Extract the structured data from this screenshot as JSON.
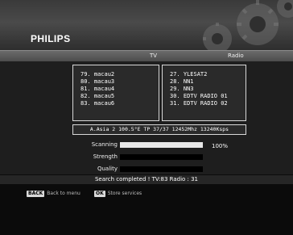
{
  "brand": "PHILIPS",
  "tabs": {
    "tv": "TV",
    "radio": "Radio"
  },
  "tv_channels": [
    "79. macau2",
    "80. macau3",
    "81. macau4",
    "82. macau5",
    "83. macau6"
  ],
  "radio_channels": [
    "27. YLESAT2",
    "28. NN1",
    "29. NN3",
    "30. EDTV RADIO 01",
    "31. EDTV RADIO 02"
  ],
  "transponder": "A.Asia 2 100.5°E TP 37/37  12452Mhz 13240Ksps",
  "scan": {
    "scanning_label": "Scanning",
    "scanning_percent": "100%",
    "scanning_progress": 1.0,
    "strength_label": "Strength",
    "strength_level": 0,
    "quality_label": "Quality",
    "quality_level": 0
  },
  "status_text": "Search completed !  TV:83  Radio : 31",
  "footer": {
    "back_key": "BACK",
    "back_label": "Back to menu",
    "ok_key": "OK",
    "ok_label": "Store services"
  },
  "colors": {
    "background": "#0b0b0b",
    "panel": "#1e1e1e",
    "text": "#ffffff",
    "bar": "#e8e8e8"
  },
  "icons": [
    "gear-icon"
  ]
}
